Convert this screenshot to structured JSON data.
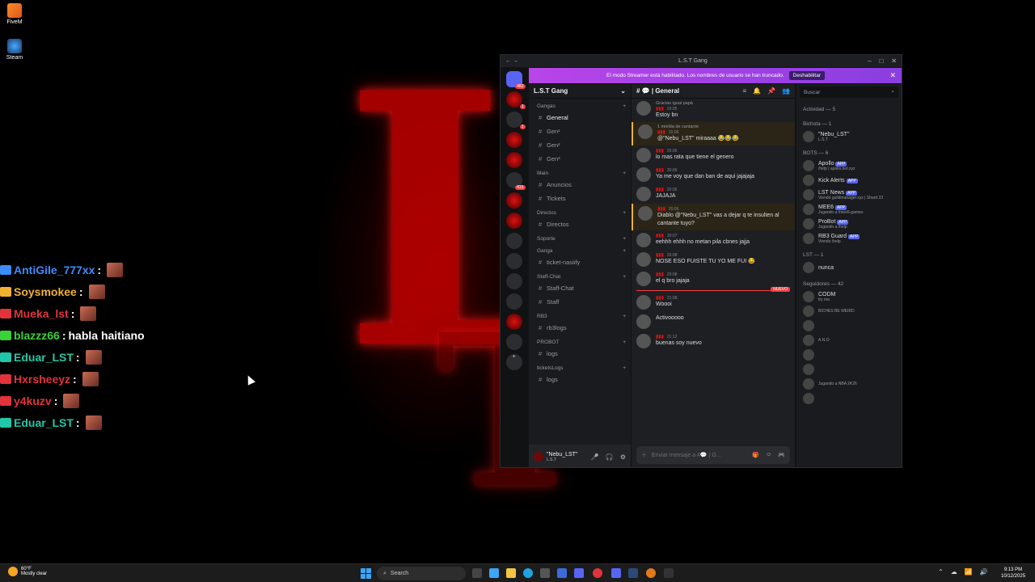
{
  "desktop": {
    "icons": [
      {
        "label": "FiveM"
      },
      {
        "label": "Steam"
      }
    ]
  },
  "stream_chat": [
    {
      "user": "AntiGile_777xx",
      "color": "#3c8cff",
      "text": ""
    },
    {
      "user": "Soysmokee",
      "color": "#f0b232",
      "text": ""
    },
    {
      "user": "Mueka_lst",
      "color": "#e0343a",
      "text": ""
    },
    {
      "user": "blazzz66",
      "color": "#3ad13a",
      "text": "habla haitiano"
    },
    {
      "user": "Eduar_LST",
      "color": "#21c7a8",
      "text": ""
    },
    {
      "user": "Hxrsheeyz",
      "color": "#e0343a",
      "text": ""
    },
    {
      "user": "y4kuzv",
      "color": "#e0343a",
      "text": ""
    },
    {
      "user": "Eduar_LST",
      "color": "#21c7a8",
      "text": ""
    }
  ],
  "discord": {
    "window_title": "L.S.T Gang",
    "streamer_banner": "El modo Streamer está habilitado. Los nombres de usuario se han truncado.",
    "disable_button": "Deshabilitar",
    "guild_name": "L.S.T Gang",
    "server_badges": [
      "482",
      "1",
      "1",
      "415",
      "3",
      "97"
    ],
    "categories": [
      {
        "name": "Gangas",
        "channels": [
          "General",
          "Gen¹",
          "Gen²",
          "Gen³"
        ]
      },
      {
        "name": "Main",
        "channels": [
          "Anuncios",
          "Tickets"
        ]
      },
      {
        "name": "Directos",
        "channels": [
          "Directos"
        ]
      },
      {
        "name": "Soporte",
        "channels": []
      },
      {
        "name": "Ganga",
        "channels": [
          "ticket-nasiify"
        ]
      },
      {
        "name": "Staff-Chat",
        "channels": [
          "Staff-Chat",
          "Staff"
        ]
      },
      {
        "name": "RB3",
        "channels": [
          "rb3logs"
        ]
      },
      {
        "name": "PROBOT",
        "channels": [
          "logs"
        ]
      },
      {
        "name": "ticketsLogs",
        "channels": [
          "logs"
        ]
      }
    ],
    "user_panel": {
      "name": "\"Nebu_LST\"",
      "sub": "L.S.T"
    },
    "chat_header": "| General",
    "messages": [
      {
        "reply": "Gracias igual papá",
        "time": "20:05",
        "text": "Estoy bn",
        "mention": false
      },
      {
        "reply": "1 mielda de cantante",
        "time": "20:06",
        "text": "@\"Nebu_LST\" miraaaa 😂😂😂",
        "mention": true
      },
      {
        "reply": "",
        "time": "20:06",
        "text": "lo mas rata que tiene el genero",
        "mention": false
      },
      {
        "reply": "",
        "time": "20:06",
        "text": "Ya me voy que dan ban de aqui jajajaja",
        "mention": false
      },
      {
        "reply": "",
        "time": "20:06",
        "text": "JAJAJA",
        "mention": false
      },
      {
        "reply": "",
        "time": "20:06",
        "text": "Diablo @\"Nebu_LST\" vas a dejar q te insulten al cantante tuyo?",
        "mention": true
      },
      {
        "reply": "",
        "time": "20:07",
        "text": "eehhh ehhh no metan pila cbnes jajja",
        "mention": false
      },
      {
        "reply": "",
        "time": "20:08",
        "text": "NOSE ESO FUISTE TU YO ME FUI 😂",
        "mention": false
      },
      {
        "reply": "",
        "time": "20:08",
        "text": "el q bro jajaja",
        "mention": false
      },
      {
        "reply": "",
        "time": "21:08",
        "text": "Woooi",
        "mention": false
      },
      {
        "reply": "",
        "time": "",
        "text": "Activooooo",
        "mention": false
      },
      {
        "reply": "",
        "time": "21:12",
        "text": "buenas soy nuevo",
        "mention": false
      }
    ],
    "new_label": "NUEVO",
    "composer_placeholder": "Enviar mensaje a #💬 | G...",
    "search_placeholder": "Buscar",
    "member_groups": [
      {
        "title": "Actividad — 5",
        "members": []
      },
      {
        "title": "Bichota — 1",
        "members": [
          {
            "name": "\"Nebu_LST\"",
            "status": "L.S.T",
            "app": ""
          }
        ]
      },
      {
        "title": "BOTS — 6",
        "members": [
          {
            "name": "Apollo",
            "status": "/help | apollo.bot.xyz",
            "app": "APP"
          },
          {
            "name": "Kick Alerts",
            "status": "",
            "app": "APP"
          },
          {
            "name": "LST News",
            "status": "Viendo guildmanager.xyz | Shard 23",
            "app": "APP"
          },
          {
            "name": "MEE6",
            "status": "Jugando a /mee6-games",
            "app": "APP"
          },
          {
            "name": "ProBot",
            "status": "Jugando a /help",
            "app": "APP"
          },
          {
            "name": "RB3 Guard",
            "status": "Viendo /help",
            "app": "APP"
          }
        ]
      },
      {
        "title": "LST — 1",
        "members": [
          {
            "name": "nunca",
            "status": "",
            "app": ""
          }
        ]
      },
      {
        "title": "Seguidores — 42",
        "members": [
          {
            "name": "CODM",
            "status": "try me.",
            "app": ""
          },
          {
            "name": "",
            "status": "BICHES BE WEIRD",
            "app": ""
          },
          {
            "name": "",
            "status": "",
            "app": ""
          },
          {
            "name": "",
            "status": "A.N.O",
            "app": ""
          },
          {
            "name": "",
            "status": "",
            "app": ""
          },
          {
            "name": "",
            "status": "",
            "app": ""
          },
          {
            "name": "",
            "status": "Jugando a NBA 2K26",
            "app": ""
          },
          {
            "name": "",
            "status": "",
            "app": ""
          }
        ]
      }
    ]
  },
  "taskbar": {
    "weather_temp": "60°F",
    "weather_desc": "Mostly clear",
    "search": "Search",
    "time": "9:13 PM",
    "date": "10/12/2025"
  }
}
